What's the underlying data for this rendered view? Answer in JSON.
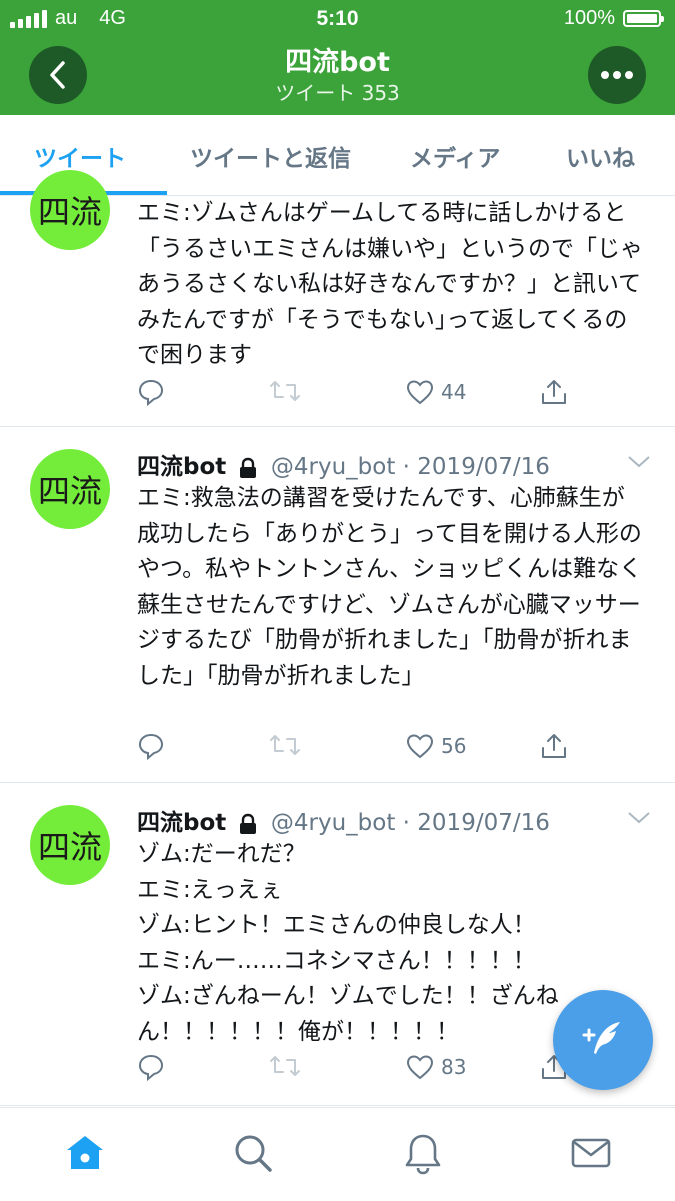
{
  "status_bar": {
    "carrier": "au",
    "network": "4G",
    "time": "5:10",
    "battery": "100%"
  },
  "header": {
    "title": "四流bot",
    "subtitle": "ツイート 353",
    "back_icon": "chevron-left-icon",
    "more_icon": "more-icon"
  },
  "tabs": [
    {
      "label": "ツイート",
      "active": true
    },
    {
      "label": "ツイートと返信",
      "active": false
    },
    {
      "label": "メディア",
      "active": false
    },
    {
      "label": "いいね",
      "active": false
    }
  ],
  "tweets": [
    {
      "avatar_text": "四流",
      "name": "",
      "handle_date": "",
      "text": "エミ:ゾムさんはゲームしてる時に話しかけると「うるさいエミさんは嫌いや」というので「じゃあうるさくない私は好きなんですか？」と訊いてみたんですが「そうでもない｣って返してくるので困ります",
      "likes": "44"
    },
    {
      "avatar_text": "四流",
      "name": "四流bot",
      "handle_date": "@4ryu_bot · 2019/07/16",
      "text": "エミ:救急法の講習を受けたんです、心肺蘇生が成功したら「ありがとう」って目を開ける人形のやつ。私やトントンさん、ショッピくんは難なく蘇生させたんですけど、ゾムさんが心臓マッサージするたび「肋骨が折れました」「肋骨が折れました」「肋骨が折れました」",
      "likes": "56"
    },
    {
      "avatar_text": "四流",
      "name": "四流bot",
      "handle_date": "@4ryu_bot · 2019/07/16",
      "text": "ゾム:だーれだ？\nエミ:えっえぇ\nゾム:ヒント！エミさんの仲良しな人！\nエミ:んー……コネシマさん！！！！！\nゾム:ざんねーん！ゾムでした！！ざんねん！！！！！！俺が！！！！！",
      "likes": "83"
    }
  ],
  "fab": {
    "icon": "compose-tweet-icon"
  },
  "bottom_nav": [
    "home-icon",
    "search-icon",
    "notifications-icon",
    "messages-icon"
  ],
  "colors": {
    "header_green": "#3ba33a",
    "accent_blue": "#1da1f2",
    "avatar_green": "#74ec3a",
    "fab_blue": "#4a9fe8"
  }
}
